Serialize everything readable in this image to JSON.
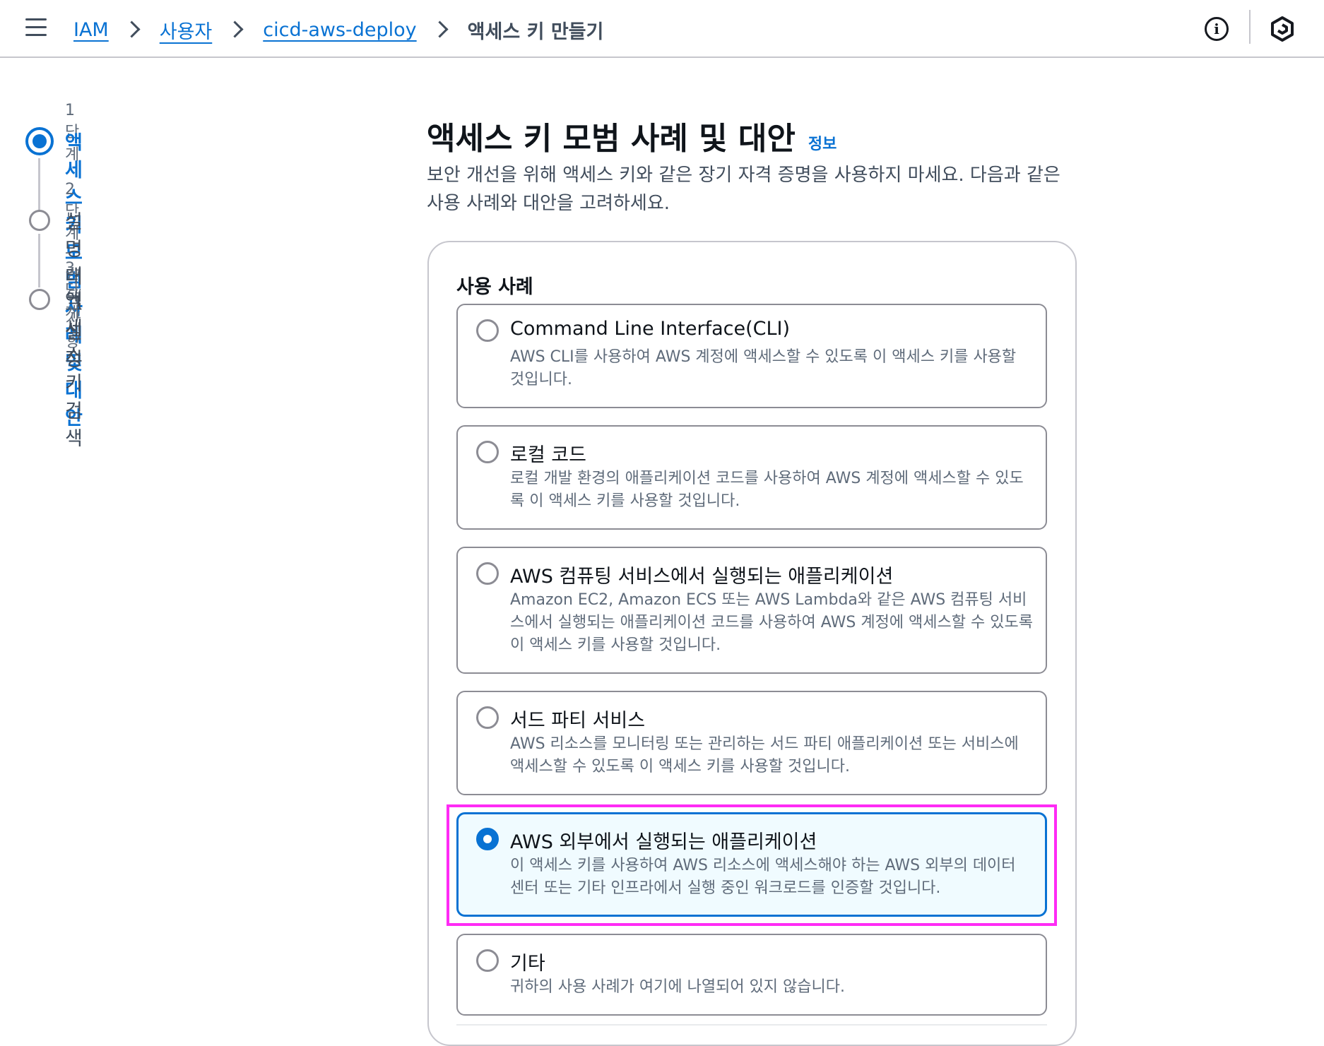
{
  "breadcrumbs": {
    "items": [
      "IAM",
      "사용자",
      "cicd-aws-deploy"
    ],
    "current": "액세스 키 만들기"
  },
  "header": {
    "info_icon": "info-circle-icon",
    "settings_icon": "hexagon-settings-icon"
  },
  "wizard": {
    "steps": [
      {
        "label": "1단계",
        "optional": "",
        "title": "액세스 키 모범 사례 및 대안",
        "active": true
      },
      {
        "label": "2단계 - ",
        "optional": "선택 사항",
        "title": "설명 태그 설정",
        "active": false
      },
      {
        "label": "3단계",
        "optional": "",
        "title": "액세스 키 검색",
        "active": false
      }
    ]
  },
  "main": {
    "title": "액세스 키 모범 사례 및 대안",
    "info_link": "정보",
    "description": "보안 개선을 위해 액세스 키와 같은 장기 자격 증명을 사용하지 마세요. 다음과 같은 사용 사례와 대안을 고려하세요.",
    "use_case_label": "사용 사례",
    "options": [
      {
        "title": "Command Line Interface(CLI)",
        "description": "AWS CLI를 사용하여 AWS 계정에 액세스할 수 있도록 이 액세스 키를 사용할 것입니다.",
        "selected": false
      },
      {
        "title": "로컬 코드",
        "description": "로컬 개발 환경의 애플리케이션 코드를 사용하여 AWS 계정에 액세스할 수 있도록 이 액세스 키를 사용할 것입니다.",
        "selected": false
      },
      {
        "title": "AWS 컴퓨팅 서비스에서 실행되는 애플리케이션",
        "description": "Amazon EC2, Amazon ECS 또는 AWS Lambda와 같은 AWS 컴퓨팅 서비스에서 실행되는 애플리케이션 코드를 사용하여 AWS 계정에 액세스할 수 있도록 이 액세스 키를 사용할 것입니다.",
        "selected": false
      },
      {
        "title": "서드 파티 서비스",
        "description": "AWS 리소스를 모니터링 또는 관리하는 서드 파티 애플리케이션 또는 서비스에 액세스할 수 있도록 이 액세스 키를 사용할 것입니다.",
        "selected": false
      },
      {
        "title": "AWS 외부에서 실행되는 애플리케이션",
        "description": "이 액세스 키를 사용하여 AWS 리소스에 액세스해야 하는 AWS 외부의 데이터 센터 또는 기타 인프라에서 실행 중인 워크로드를 인증할 것입니다.",
        "selected": true
      },
      {
        "title": "기타",
        "description": "귀하의 사용 사례가 여기에 나열되어 있지 않습니다.",
        "selected": false
      }
    ]
  },
  "colors": {
    "accent": "#0972d3",
    "selected_bg": "#f0fbff",
    "highlight": "#ff2bf5"
  }
}
